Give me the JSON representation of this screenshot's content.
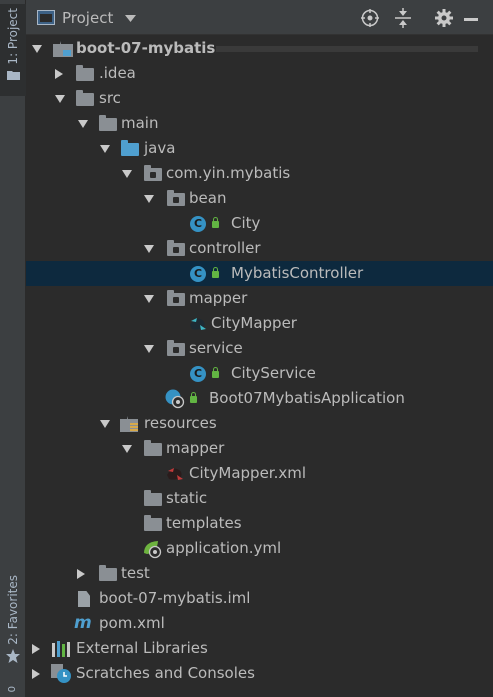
{
  "toolstrip": {
    "project_tab": "1: Project",
    "favorites_tab": "2: Favorites",
    "bottom_tab": "0"
  },
  "header": {
    "title": "Project"
  },
  "tree": [
    {
      "label": "boot-07-mybatis"
    },
    {
      "label": ".idea"
    },
    {
      "label": "src"
    },
    {
      "label": "main"
    },
    {
      "label": "java"
    },
    {
      "label": "com.yin.mybatis"
    },
    {
      "label": "bean"
    },
    {
      "label": "City"
    },
    {
      "label": "controller"
    },
    {
      "label": "MybatisController"
    },
    {
      "label": "mapper"
    },
    {
      "label": "CityMapper"
    },
    {
      "label": "service"
    },
    {
      "label": "CityService"
    },
    {
      "label": "Boot07MybatisApplication"
    },
    {
      "label": "resources"
    },
    {
      "label": "mapper"
    },
    {
      "label": "CityMapper.xml"
    },
    {
      "label": "static"
    },
    {
      "label": "templates"
    },
    {
      "label": "application.yml"
    },
    {
      "label": "test"
    },
    {
      "label": "boot-07-mybatis.iml"
    },
    {
      "label": "pom.xml"
    },
    {
      "label": "External Libraries"
    },
    {
      "label": "Scratches and Consoles"
    }
  ],
  "colors": {
    "background": "#2b2b2b",
    "panel": "#3c3f41",
    "selection": "#0d293e",
    "folder": "#8a8f94",
    "source_folder": "#4f9fcf",
    "class_icon": "#3592c4",
    "lock": "#62b543",
    "text": "#bbbbbb"
  },
  "icons": [
    "project-window-icon",
    "chevron-down-icon",
    "locate-icon",
    "collapse-all-icon",
    "gear-icon",
    "minimize-icon",
    "star-icon",
    "folder-icon",
    "package-icon",
    "class-icon",
    "lock-icon",
    "mybatis-mapper-icon",
    "spring-boot-icon",
    "xml-icon",
    "yml-icon",
    "iml-file-icon",
    "maven-icon",
    "libraries-icon",
    "scratches-icon"
  ]
}
